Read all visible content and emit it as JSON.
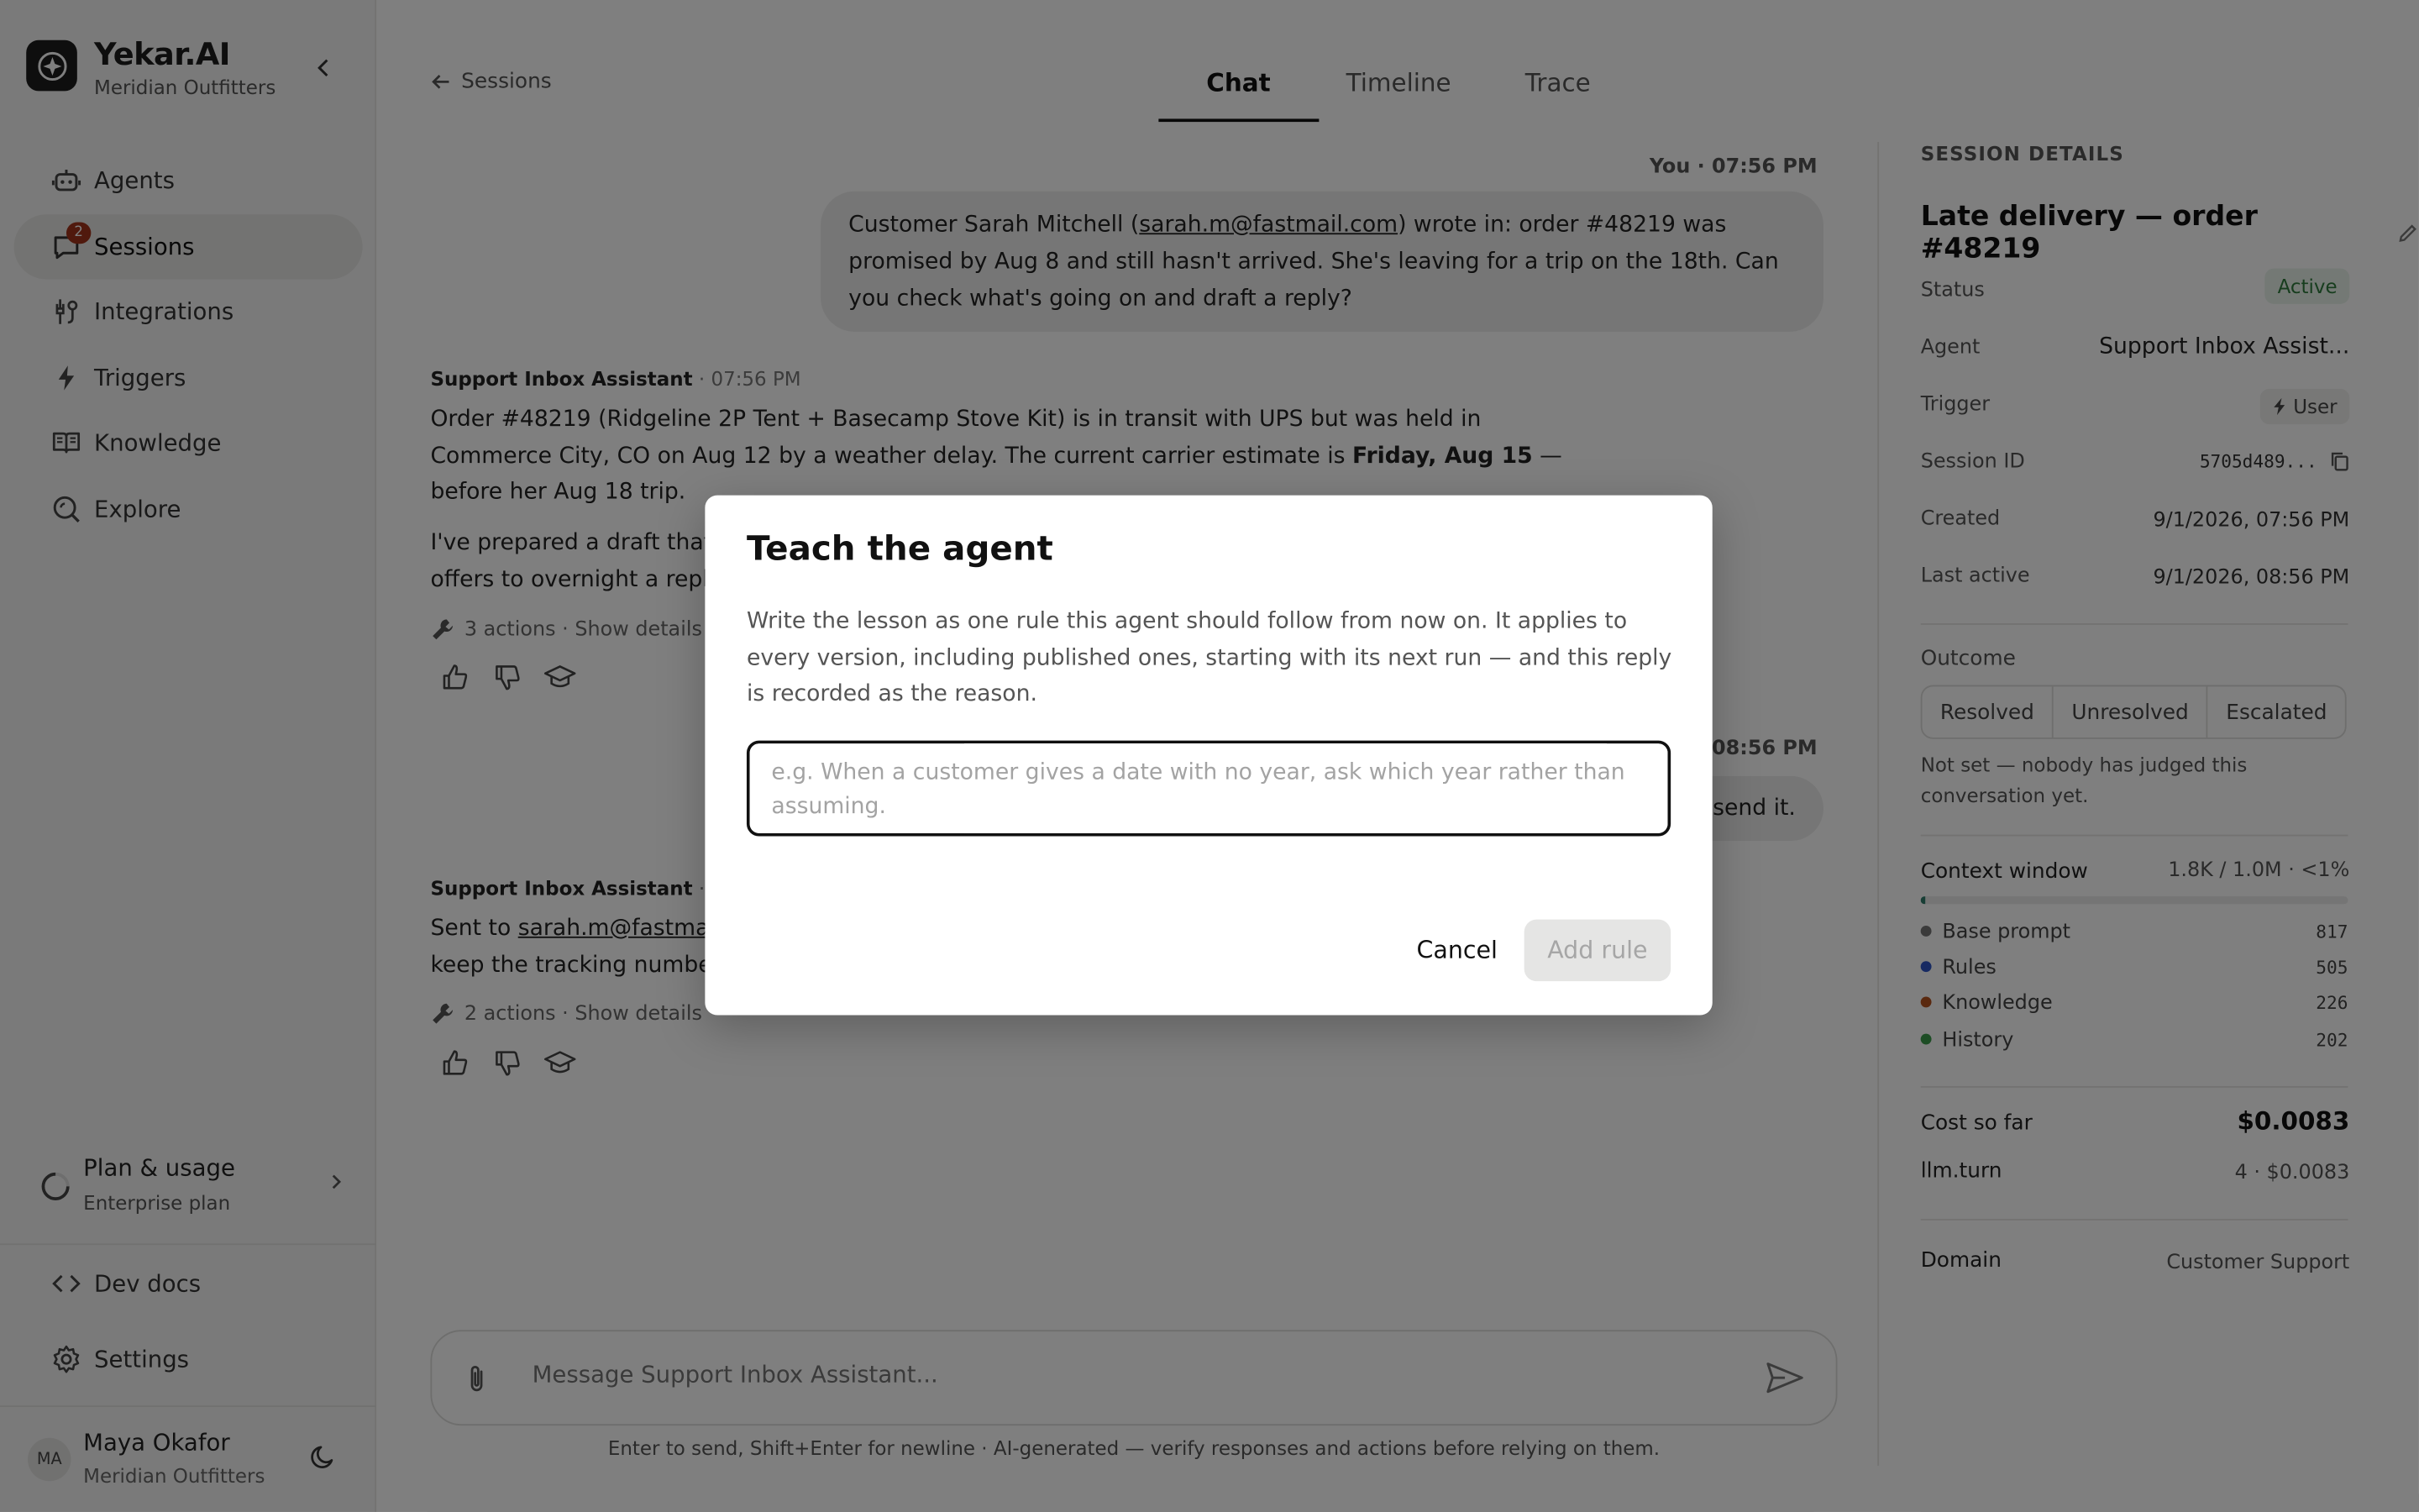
{
  "brand": {
    "title": "Yekar.AI",
    "subtitle": "Meridian Outfitters"
  },
  "nav": [
    {
      "label": "Agents",
      "icon": "robot-icon"
    },
    {
      "label": "Sessions",
      "icon": "chat-icon",
      "badge": "2",
      "active": true
    },
    {
      "label": "Integrations",
      "icon": "integrations-icon"
    },
    {
      "label": "Triggers",
      "icon": "bolt-icon"
    },
    {
      "label": "Knowledge",
      "icon": "book-icon"
    },
    {
      "label": "Explore",
      "icon": "explore-icon"
    }
  ],
  "plan": {
    "title": "Plan & usage",
    "subtitle": "Enterprise plan"
  },
  "links": {
    "dev_docs": "Dev docs",
    "settings": "Settings"
  },
  "user": {
    "initials": "MA",
    "name": "Maya Okafor",
    "org": "Meridian Outfitters"
  },
  "header": {
    "back": "Sessions",
    "tabs": [
      {
        "label": "Chat",
        "active": true
      },
      {
        "label": "Timeline"
      },
      {
        "label": "Trace"
      }
    ]
  },
  "chat": {
    "msg1_meta": "You · 07:56 PM",
    "msg1_a": "Customer Sarah Mitchell (",
    "msg1_email": "sarah.m@fastmail.com",
    "msg1_b": ") wrote in: order #48219 was promised by Aug 8 and still hasn't arrived. She's leaving for a trip on the 18th. Can you check what's going on and draft a reply?",
    "agent_name": "Support Inbox Assistant",
    "msg2_time": " · 07:56 PM",
    "msg2_p1a": "Order #48219 (Ridgeline 2P Tent + Basecamp Stove Kit) is in transit with UPS but was held in Commerce City, CO on Aug 12 by a weather delay. The current carrier estimate is ",
    "msg2_p1b": "Friday, Aug 15",
    "msg2_p1c": " — before her Aug 18 trip.",
    "msg2_p2": "I've prepared a draft that",
    "msg2_p2b": "offers to overnight a repla",
    "msg2_actions": "3 actions · Show details",
    "msg3_meta": "08:56 PM",
    "msg3_text": "send it.",
    "msg4_time": " · 08",
    "msg4_a": "Sent to ",
    "msg4_email": "sarah.m@fastmai",
    "msg4_b": "keep the tracking numbe",
    "msg4_actions": "2 actions · Show details"
  },
  "composer": {
    "placeholder": "Message Support Inbox Assistant...",
    "disclaimer": "Enter to send, Shift+Enter for newline · AI-generated — verify responses and actions before relying on them."
  },
  "details": {
    "heading": "SESSION DETAILS",
    "title": "Late delivery — order #48219",
    "status_label": "Status",
    "status_value": "Active",
    "agent_label": "Agent",
    "agent_value": "Support Inbox Assist...",
    "trigger_label": "Trigger",
    "trigger_value": "User",
    "session_label": "Session ID",
    "session_value": "5705d489...",
    "created_label": "Created",
    "created_value": "9/1/2026, 07:56 PM",
    "last_label": "Last active",
    "last_value": "9/1/2026, 08:56 PM",
    "outcome_label": "Outcome",
    "outcomes": [
      "Resolved",
      "Unresolved",
      "Escalated"
    ],
    "outcome_note": "Not set — nobody has judged this conversation yet.",
    "ctx_label": "Context window",
    "ctx_value": "1.8K / 1.0M · <1%",
    "ctx_fraction": 0.01,
    "ctx_items": [
      {
        "label": "Base prompt",
        "value": "817",
        "color": "#777777"
      },
      {
        "label": "Rules",
        "value": "505",
        "color": "#2f55c4"
      },
      {
        "label": "Knowledge",
        "value": "226",
        "color": "#b5531f"
      },
      {
        "label": "History",
        "value": "202",
        "color": "#3a9a4a"
      }
    ],
    "cost_label": "Cost so far",
    "cost_value": "$0.0083",
    "llm_label": "llm.turn",
    "llm_value": "4 · $0.0083",
    "domain_label": "Domain",
    "domain_value": "Customer Support"
  },
  "modal": {
    "title": "Teach the agent",
    "description": "Write the lesson as one rule this agent should follow from now on. It applies to every version, including published ones, starting with its next run — and this reply is recorded as the reason.",
    "placeholder": "e.g. When a customer gives a date with no year, ask which year rather than assuming.",
    "cancel": "Cancel",
    "add": "Add rule"
  }
}
